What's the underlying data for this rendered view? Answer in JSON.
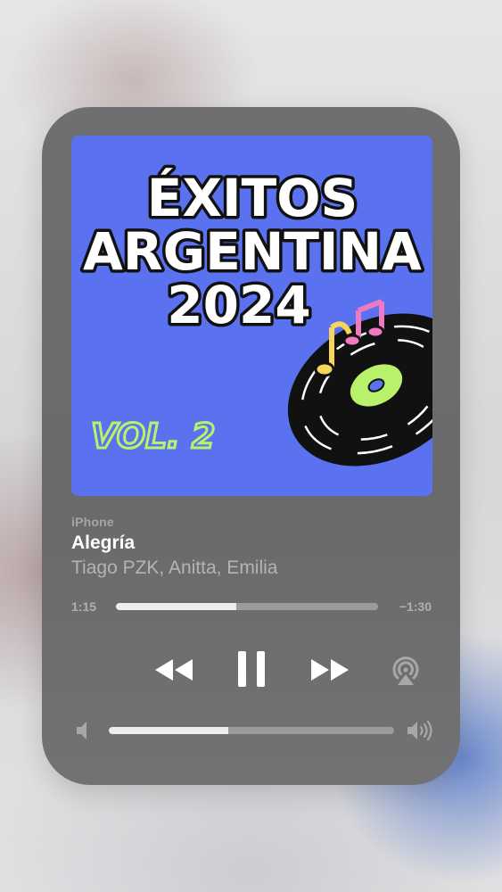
{
  "now_playing": {
    "device": "iPhone",
    "track_title": "Alegría",
    "artists": "Tiago PZK, Anitta, Emilia",
    "elapsed": "1:15",
    "remaining": "−1:30",
    "progress_fraction": 0.46,
    "volume_fraction": 0.42,
    "state": "playing"
  },
  "artwork": {
    "line1": "ÉXITOS",
    "line2": "ARGENTINA",
    "line3": "2024",
    "volume_label": "VOL. 2",
    "background_color": "#5a72f0",
    "label_color": "#b8f26a",
    "note_colors": [
      "#f5d55a",
      "#f07ac0"
    ]
  },
  "icons": {
    "rewind": "rewind-icon",
    "pause": "pause-icon",
    "forward": "fast-forward-icon",
    "airplay": "airplay-icon",
    "volume_low": "speaker-low-icon",
    "volume_high": "speaker-high-icon"
  },
  "colors": {
    "panel": "#6d6d6f",
    "track": "#9b9b9d",
    "fill": "#ededed",
    "primary_text": "#ffffff",
    "secondary_text": "#b4b4b6"
  }
}
